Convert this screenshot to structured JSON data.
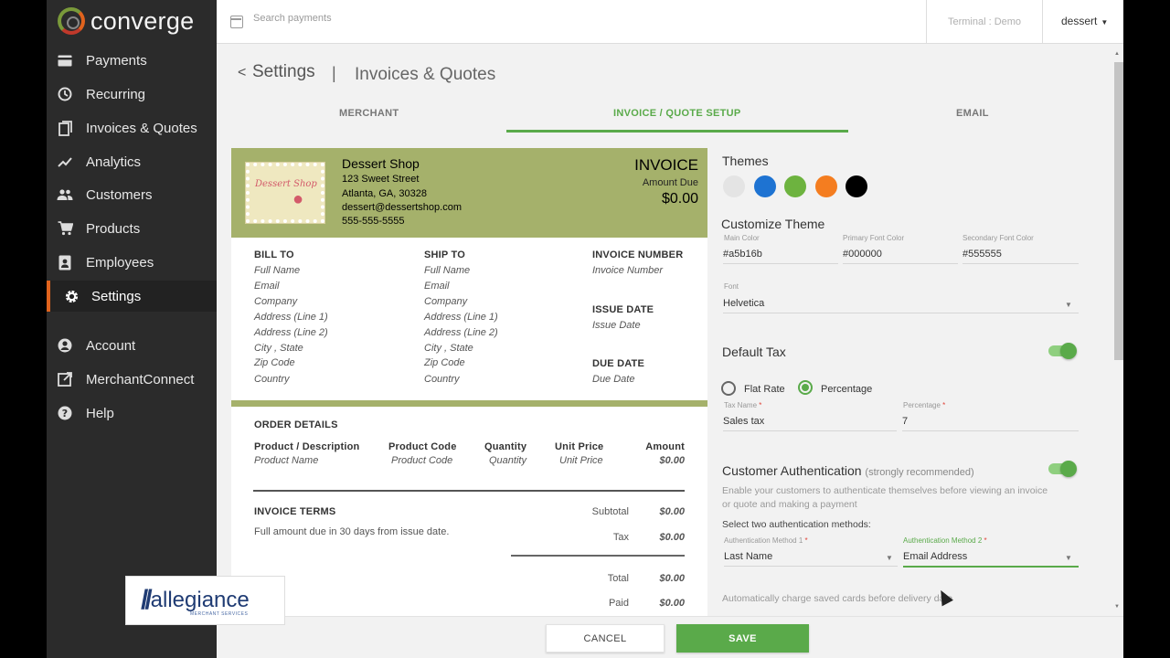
{
  "app": {
    "brand": "converge"
  },
  "sidebar": {
    "items": [
      {
        "label": "Payments",
        "icon": "card-icon"
      },
      {
        "label": "Recurring",
        "icon": "clock-icon"
      },
      {
        "label": "Invoices & Quotes",
        "icon": "document-icon"
      },
      {
        "label": "Analytics",
        "icon": "trend-icon"
      },
      {
        "label": "Customers",
        "icon": "people-icon"
      },
      {
        "label": "Products",
        "icon": "cart-icon"
      },
      {
        "label": "Employees",
        "icon": "badge-icon"
      },
      {
        "label": "Settings",
        "icon": "gear-icon",
        "active": true
      },
      {
        "label": "Account",
        "icon": "user-icon"
      },
      {
        "label": "MerchantConnect",
        "icon": "external-link-icon"
      },
      {
        "label": "Help",
        "icon": "help-icon"
      }
    ],
    "partner_logo": {
      "name": "allegiance",
      "tagline": "MERCHANT SERVICES"
    }
  },
  "header": {
    "search_placeholder": "Search payments",
    "terminal": "Terminal : Demo",
    "user": "dessert"
  },
  "breadcrumb": {
    "parent": "Settings",
    "separator": "|",
    "current": "Invoices & Quotes"
  },
  "tabs": [
    {
      "label": "MERCHANT",
      "active": false
    },
    {
      "label": "INVOICE / QUOTE SETUP",
      "active": true
    },
    {
      "label": "EMAIL",
      "active": false
    }
  ],
  "invoice": {
    "shop_name": "Dessert Shop",
    "address1": "123 Sweet Street",
    "address2": "Atlanta, GA, 30328",
    "email": "dessert@dessertshop.com",
    "phone": "555-555-5555",
    "title": "INVOICE",
    "amount_due_label": "Amount Due",
    "amount_due": "$0.00",
    "bill_to": {
      "heading": "BILL TO",
      "lines": [
        "Full Name",
        "Email",
        "Company",
        "Address (Line 1)",
        "Address (Line 2)",
        "City , State",
        "Zip Code",
        "Country"
      ]
    },
    "ship_to": {
      "heading": "SHIP TO",
      "lines": [
        "Full Name",
        "Email",
        "Company",
        "Address (Line 1)",
        "Address (Line 2)",
        "City , State",
        "Zip Code",
        "Country"
      ]
    },
    "invoice_number": {
      "heading": "INVOICE NUMBER",
      "value": "Invoice Number"
    },
    "issue_date": {
      "heading": "ISSUE DATE",
      "value": "Issue Date"
    },
    "due_date": {
      "heading": "DUE DATE",
      "value": "Due Date"
    },
    "order_details": {
      "heading": "ORDER DETAILS",
      "columns": [
        "Product / Description",
        "Product Code",
        "Quantity",
        "Unit Price",
        "Amount"
      ],
      "row": [
        "Product Name",
        "Product Code",
        "Quantity",
        "Unit Price",
        "$0.00"
      ]
    },
    "terms": {
      "heading": "INVOICE TERMS",
      "text": "Full amount due in 30 days from issue date."
    },
    "totals": [
      {
        "label": "Subtotal",
        "value": "$0.00"
      },
      {
        "label": "Tax",
        "value": "$0.00"
      },
      {
        "label": "Total",
        "value": "$0.00"
      },
      {
        "label": "Paid",
        "value": "$0.00"
      }
    ]
  },
  "settings_panel": {
    "themes_heading": "Themes",
    "theme_colors": [
      "#e4e4e4",
      "#1e73d2",
      "#6db33f",
      "#f47d20",
      "#000000"
    ],
    "customize_heading": "Customize Theme",
    "main_color_label": "Main Color",
    "main_color": "#a5b16b",
    "primary_font_color_label": "Primary Font Color",
    "primary_font_color": "#000000",
    "secondary_font_color_label": "Secondary Font Color",
    "secondary_font_color": "#555555",
    "font_label": "Font",
    "font_value": "Helvetica",
    "default_tax_heading": "Default Tax",
    "default_tax_enabled": true,
    "flat_rate_label": "Flat Rate",
    "percentage_label": "Percentage",
    "tax_type": "Percentage",
    "tax_name_label": "Tax Name",
    "tax_name": "Sales tax",
    "percentage_field_label": "Percentage",
    "percentage_value": "7",
    "customer_auth_heading": "Customer Authentication",
    "customer_auth_hint": "(strongly recommended)",
    "customer_auth_enabled": true,
    "customer_auth_desc_1": "Enable your customers to authenticate themselves before viewing an invoice",
    "customer_auth_desc_2": "or quote and making a payment",
    "select_methods_label": "Select two authentication methods:",
    "auth_method_1_label": "Authentication Method 1",
    "auth_method_1": "Last Name",
    "auth_method_2_label": "Authentication Method 2",
    "auth_method_2": "Email Address",
    "auto_charge_text": "Automatically charge saved cards before delivery date"
  },
  "actions": {
    "cancel": "CANCEL",
    "save": "SAVE"
  },
  "colors": {
    "accent": "#5aaa4a",
    "sidebar_bg": "#2b2b2b",
    "active_marker": "#e0631d"
  }
}
